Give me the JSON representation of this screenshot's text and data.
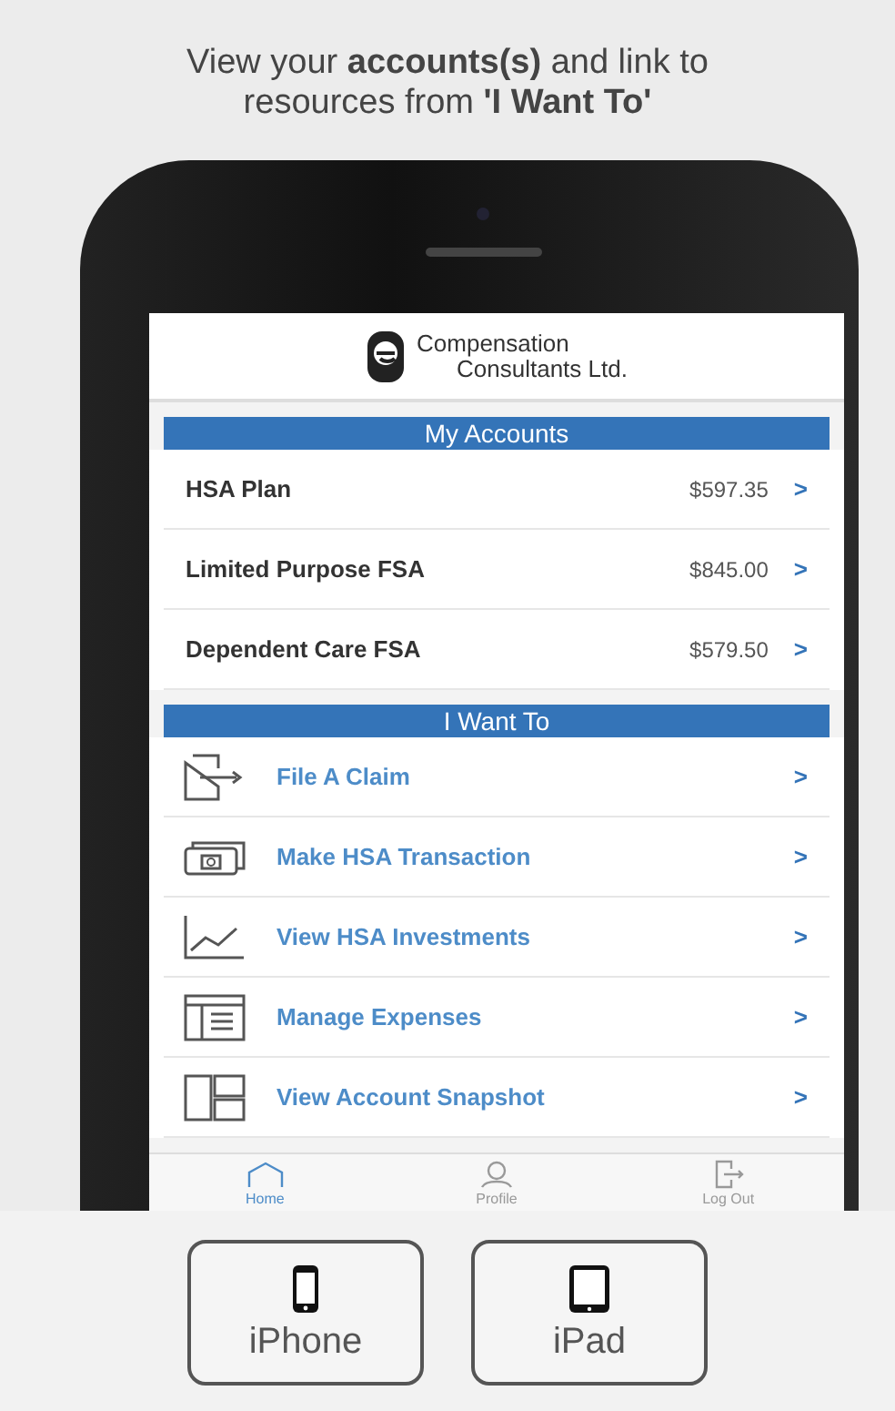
{
  "headline": "View your **accounts(s)** and link to resources from **'I Want To'**",
  "app": {
    "company_name_line1": "Compensation",
    "company_name_line2": "Consultants Ltd.",
    "accounts_header": "My Accounts",
    "accounts": [
      {
        "name": "HSA Plan",
        "balance": "$597.35",
        "chevron": ">"
      },
      {
        "name": "Limited Purpose FSA",
        "balance": "$845.00",
        "chevron": ">"
      },
      {
        "name": "Dependent Care FSA",
        "balance": "$579.50",
        "chevron": ">"
      }
    ],
    "actions_header": "I Want To",
    "actions": [
      {
        "kind": "claim",
        "label": "File A Claim",
        "chevron": ">"
      },
      {
        "kind": "transaction",
        "label": "Make HSA Transaction",
        "chevron": ">"
      },
      {
        "kind": "investments",
        "label": "View HSA Investments",
        "chevron": ">"
      },
      {
        "kind": "expenses",
        "label": "Manage Expenses",
        "chevron": ">"
      },
      {
        "kind": "snapshot",
        "label": "View Account Snapshot",
        "chevron": ">"
      }
    ],
    "tab_bar": [
      {
        "kind": "home",
        "label": "Home",
        "selected": true
      },
      {
        "kind": "profile",
        "label": "Profile",
        "selected": false
      },
      {
        "kind": "logout",
        "label": "Log Out",
        "selected": false
      }
    ]
  },
  "device_buttons": [
    {
      "kind": "phone",
      "label": "iPhone",
      "selected": false
    },
    {
      "kind": "tablet",
      "label": "iPad",
      "selected": false
    }
  ]
}
